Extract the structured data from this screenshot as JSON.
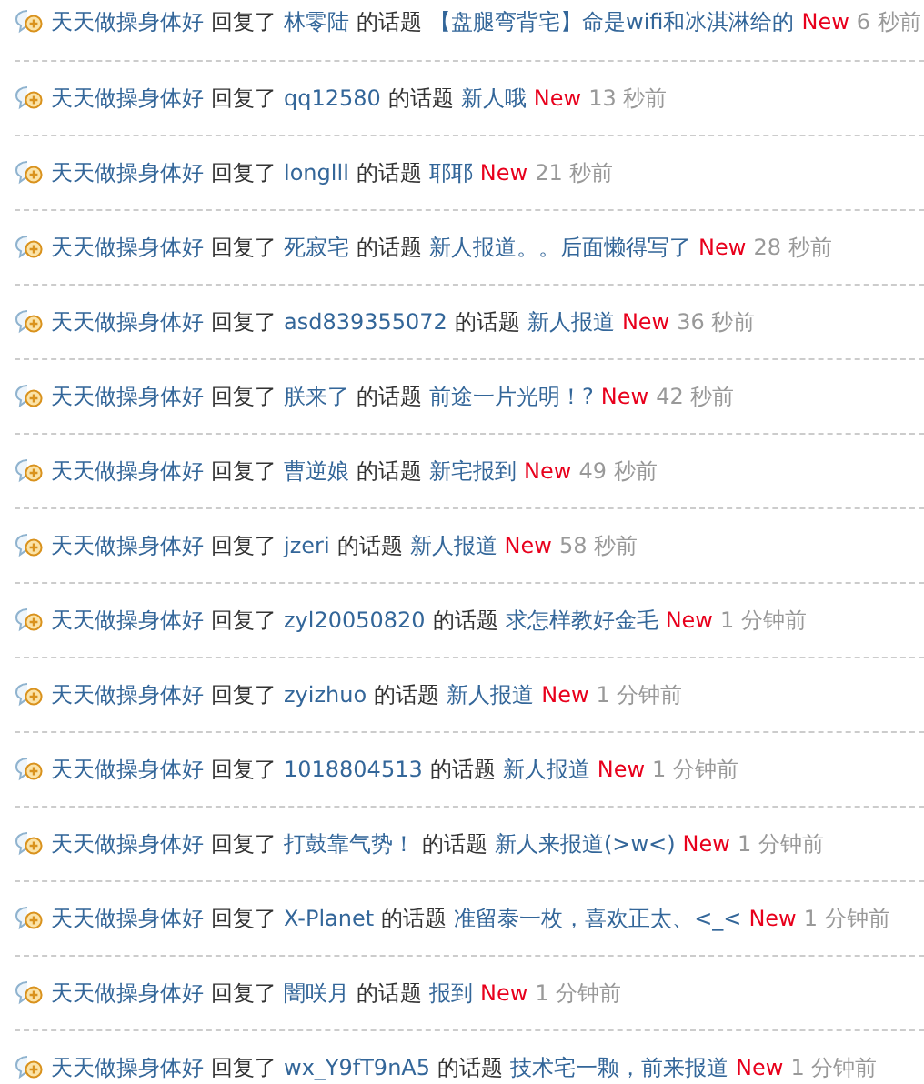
{
  "feed": [
    {
      "user": "天天做操身体好",
      "action": "回复了",
      "author": "林零陆",
      "connector": "的话题",
      "topic": "【盘腿弯背宅】命是wifi和冰淇淋给的",
      "badge": "New",
      "time": "6 秒前"
    },
    {
      "user": "天天做操身体好",
      "action": "回复了",
      "author": "qq12580",
      "connector": "的话题",
      "topic": "新人哦",
      "badge": "New",
      "time": "13 秒前"
    },
    {
      "user": "天天做操身体好",
      "action": "回复了",
      "author": "longlll",
      "connector": "的话题",
      "topic": "耶耶",
      "badge": "New",
      "time": "21 秒前"
    },
    {
      "user": "天天做操身体好",
      "action": "回复了",
      "author": "死寂宅",
      "connector": "的话题",
      "topic": "新人报道。。后面懒得写了",
      "badge": "New",
      "time": "28 秒前"
    },
    {
      "user": "天天做操身体好",
      "action": "回复了",
      "author": "asd839355072",
      "connector": "的话题",
      "topic": "新人报道",
      "badge": "New",
      "time": "36 秒前"
    },
    {
      "user": "天天做操身体好",
      "action": "回复了",
      "author": "朕来了",
      "connector": "的话题",
      "topic": "前途一片光明！?",
      "badge": "New",
      "time": "42 秒前"
    },
    {
      "user": "天天做操身体好",
      "action": "回复了",
      "author": "曹逆娘",
      "connector": "的话题",
      "topic": "新宅报到",
      "badge": "New",
      "time": "49 秒前"
    },
    {
      "user": "天天做操身体好",
      "action": "回复了",
      "author": "jzeri",
      "connector": "的话题",
      "topic": "新人报道",
      "badge": "New",
      "time": "58 秒前"
    },
    {
      "user": "天天做操身体好",
      "action": "回复了",
      "author": "zyl20050820",
      "connector": "的话题",
      "topic": "求怎样教好金毛",
      "badge": "New",
      "time": "1 分钟前"
    },
    {
      "user": "天天做操身体好",
      "action": "回复了",
      "author": "zyizhuo",
      "connector": "的话题",
      "topic": "新人报道",
      "badge": "New",
      "time": "1 分钟前"
    },
    {
      "user": "天天做操身体好",
      "action": "回复了",
      "author": "1018804513",
      "connector": "的话题",
      "topic": "新人报道",
      "badge": "New",
      "time": "1 分钟前"
    },
    {
      "user": "天天做操身体好",
      "action": "回复了",
      "author": "打鼓靠气势！",
      "connector": "的话题",
      "topic": "新人来报道(>w<)",
      "badge": "New",
      "time": "1 分钟前"
    },
    {
      "user": "天天做操身体好",
      "action": "回复了",
      "author": "X-Planet",
      "connector": "的话题",
      "topic": "准留泰一枚，喜欢正太、<_<",
      "badge": "New",
      "time": "1 分钟前"
    },
    {
      "user": "天天做操身体好",
      "action": "回复了",
      "author": "闇咲月",
      "connector": "的话题",
      "topic": "报到",
      "badge": "New",
      "time": "1 分钟前"
    },
    {
      "user": "天天做操身体好",
      "action": "回复了",
      "author": "wx_Y9fT9nA5",
      "connector": "的话题",
      "topic": "技术宅一颗，前来报道",
      "badge": "New",
      "time": "1 分钟前"
    }
  ]
}
